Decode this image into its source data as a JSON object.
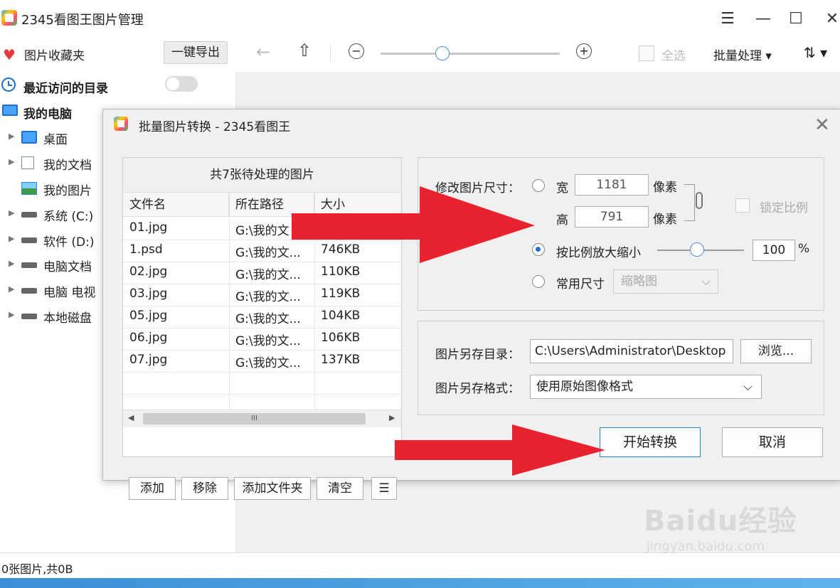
{
  "app": {
    "title": "2345看图王图片管理"
  },
  "window_controls": {
    "menu": "☰",
    "minimize": "—",
    "maximize": "☐",
    "close": "✕"
  },
  "toolbar": {
    "favorites_label": "图片收藏夹",
    "export_label": "一键导出",
    "back_icon": "←",
    "up_icon": "⇧",
    "zoom_out_icon": "−",
    "zoom_in_icon": "+",
    "select_all_label": "全选",
    "batch_label": "批量处理 ▾",
    "sort_label": "⇅ ▾"
  },
  "sidebar": {
    "recent_label": "最近访问的目录",
    "computer_label": "我的电脑",
    "items": [
      {
        "label": "桌面",
        "icon": "monitor-icon"
      },
      {
        "label": "我的文档",
        "icon": "document-icon"
      },
      {
        "label": "我的图片",
        "icon": "picture-icon"
      },
      {
        "label": "系统 (C:)",
        "icon": "drive-icon"
      },
      {
        "label": "软件 (D:)",
        "icon": "drive-icon"
      },
      {
        "label": "电脑文档",
        "icon": "drive-icon"
      },
      {
        "label": "电脑 电视",
        "icon": "drive-icon"
      },
      {
        "label": "本地磁盘",
        "icon": "drive-icon"
      }
    ]
  },
  "status": {
    "text": "0张图片,共0B"
  },
  "dialog": {
    "title": "批量图片转换 - 2345看图王",
    "list": {
      "header": "共7张待处理的图片",
      "columns": [
        "文件名",
        "所在路径",
        "大小"
      ],
      "rows": [
        {
          "name": "01.jpg",
          "path": "G:\\我的文",
          "size": ""
        },
        {
          "name": "1.psd",
          "path": "G:\\我的文...",
          "size": "746KB"
        },
        {
          "name": "02.jpg",
          "path": "G:\\我的文...",
          "size": "110KB"
        },
        {
          "name": "03.jpg",
          "path": "G:\\我的文...",
          "size": "119KB"
        },
        {
          "name": "05.jpg",
          "path": "G:\\我的文...",
          "size": "104KB"
        },
        {
          "name": "06.jpg",
          "path": "G:\\我的文...",
          "size": "106KB"
        },
        {
          "name": "07.jpg",
          "path": "G:\\我的文...",
          "size": "137KB"
        }
      ],
      "scroll_thumb": "III",
      "buttons": {
        "add": "添加",
        "remove": "移除",
        "add_folder": "添加文件夹",
        "clear": "清空"
      }
    },
    "resize": {
      "label": "修改图片尺寸：",
      "width_label": "宽",
      "width_value": "1181",
      "height_label": "高",
      "height_value": "791",
      "unit": "像素",
      "lock_ratio_label": "锁定比例",
      "scale_label": "按比例放大缩小",
      "scale_value": "100",
      "scale_unit": "%",
      "scale_slider_fraction": 0.45,
      "preset_label": "常用尺寸",
      "preset_value": "缩略图"
    },
    "output": {
      "dir_label": "图片另存目录：",
      "dir_value": "C:\\Users\\Administrator\\Desktop",
      "browse_label": "浏览...",
      "format_label": "图片另存格式：",
      "format_value": "使用原始图像格式"
    },
    "start_label": "开始转换",
    "cancel_label": "取消"
  },
  "watermark": {
    "line1": "Baidu经验",
    "line2": "jingyan.baidu.com"
  },
  "colors": {
    "accent": "#1f6fd1",
    "arrow_red": "#e8222f",
    "favorite_red": "#e23b3b"
  }
}
